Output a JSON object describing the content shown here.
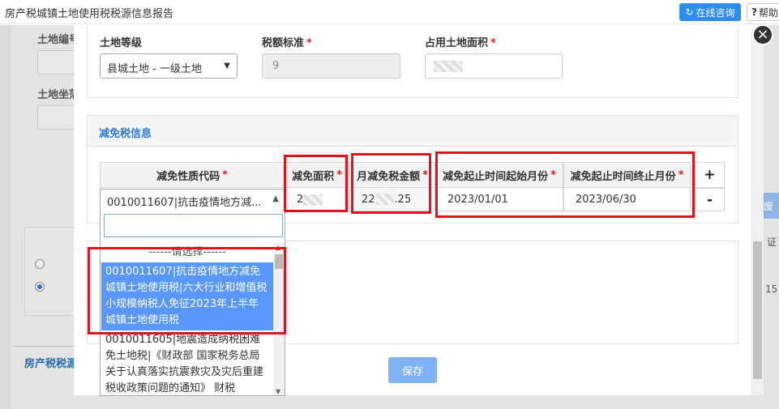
{
  "window": {
    "title": "房产税城镇土地使用税税源信息报告",
    "consult_label": "在线咨询",
    "help_label": "帮助"
  },
  "background": {
    "label_land_no": "土地编号",
    "label_land_loc": "土地坐落",
    "section_title": "房产税税源",
    "right_btn": "废",
    "right_text_1": "证",
    "right_text_2": "15"
  },
  "form": {
    "land_grade_label": "土地等级",
    "land_grade_value": "县城土地 - 一级土地",
    "tax_standard_label": "税额标准",
    "tax_standard_value": "9",
    "land_area_label": "占用土地面积",
    "required_mark": "*"
  },
  "exemption": {
    "section_title": "减免税信息",
    "columns": [
      "减免性质代码",
      "减免面积",
      "月减免税金额",
      "减免起止时间起始月份",
      "减免起止时间终止月份"
    ],
    "row": {
      "code": "0010011607|抗击疫情地方减...",
      "area": "2",
      "monthly_amount_prefix": "22",
      "monthly_amount_suffix": ".25",
      "start_month": "2023/01/01",
      "end_month": "2023/06/30"
    },
    "add_label": "+",
    "remove_label": "-"
  },
  "dropdown": {
    "search_value": "",
    "options": [
      "------请选择------",
      "0010011607|抗击疫情地方减免城镇土地使用税|六大行业和增值税小规模纳税人免征2023年上半年城镇土地使用税",
      "0010011605|地震造成纳税困难免土地税|《财政部 国家税务总局关于认真落实抗震救灾及灾后重建税收政策问题的通知》 财税"
    ],
    "selected_index": 1
  },
  "actions": {
    "save_label": "保存",
    "close_label": "×"
  }
}
